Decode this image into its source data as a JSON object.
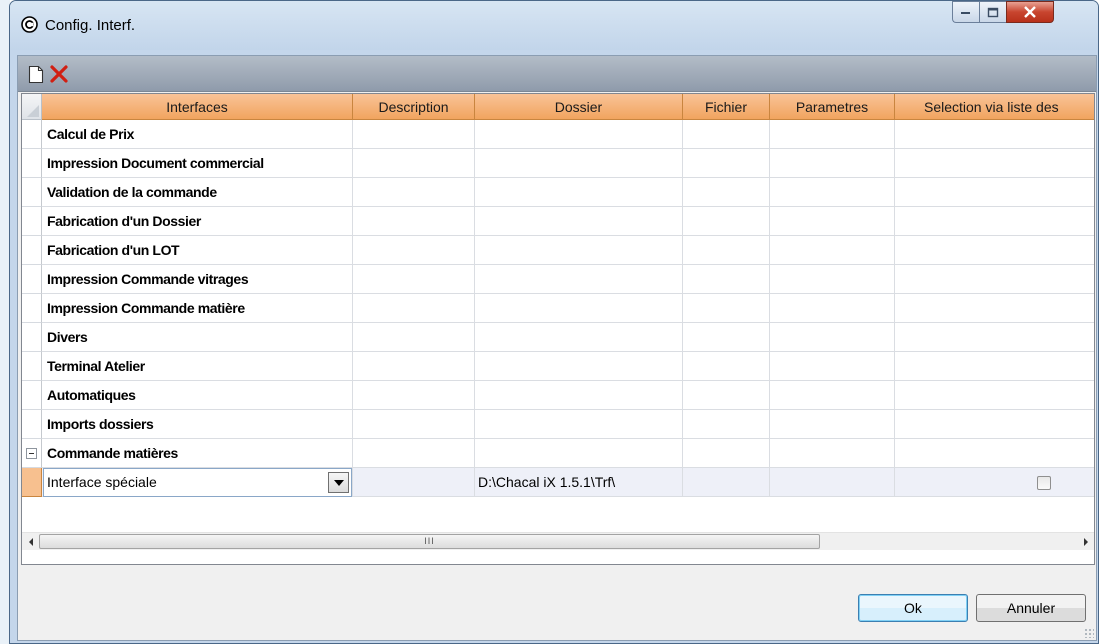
{
  "window": {
    "title": "Config. Interf."
  },
  "toolbar": {
    "new_icon": "new-document-icon",
    "delete_icon": "delete-x-icon"
  },
  "grid": {
    "columns": [
      "Interfaces",
      "Description",
      "Dossier",
      "Fichier",
      "Parametres",
      "Selection via liste des"
    ],
    "groups": [
      "Calcul de Prix",
      "Impression Document commercial",
      "Validation de la commande",
      "Fabrication d'un Dossier",
      "Fabrication d'un LOT",
      "Impression Commande vitrages",
      "Impression Commande matière",
      "Divers",
      "Terminal Atelier",
      "Automatiques",
      "Imports dossiers",
      "Commande matières"
    ],
    "expanded_group": "Commande matières",
    "subrow": {
      "interface_value": "Interface spéciale",
      "dossier": "D:\\Chacal iX 1.5.1\\Trf\\",
      "selection_checked": false
    },
    "scroll_grip": "III"
  },
  "buttons": {
    "ok": "Ok",
    "cancel": "Annuler"
  },
  "colors": {
    "header_orange": "#f1a45f",
    "title_bar": "#c4d6eb",
    "toolbar": "#9aa6b5",
    "close_red": "#c8452f"
  }
}
